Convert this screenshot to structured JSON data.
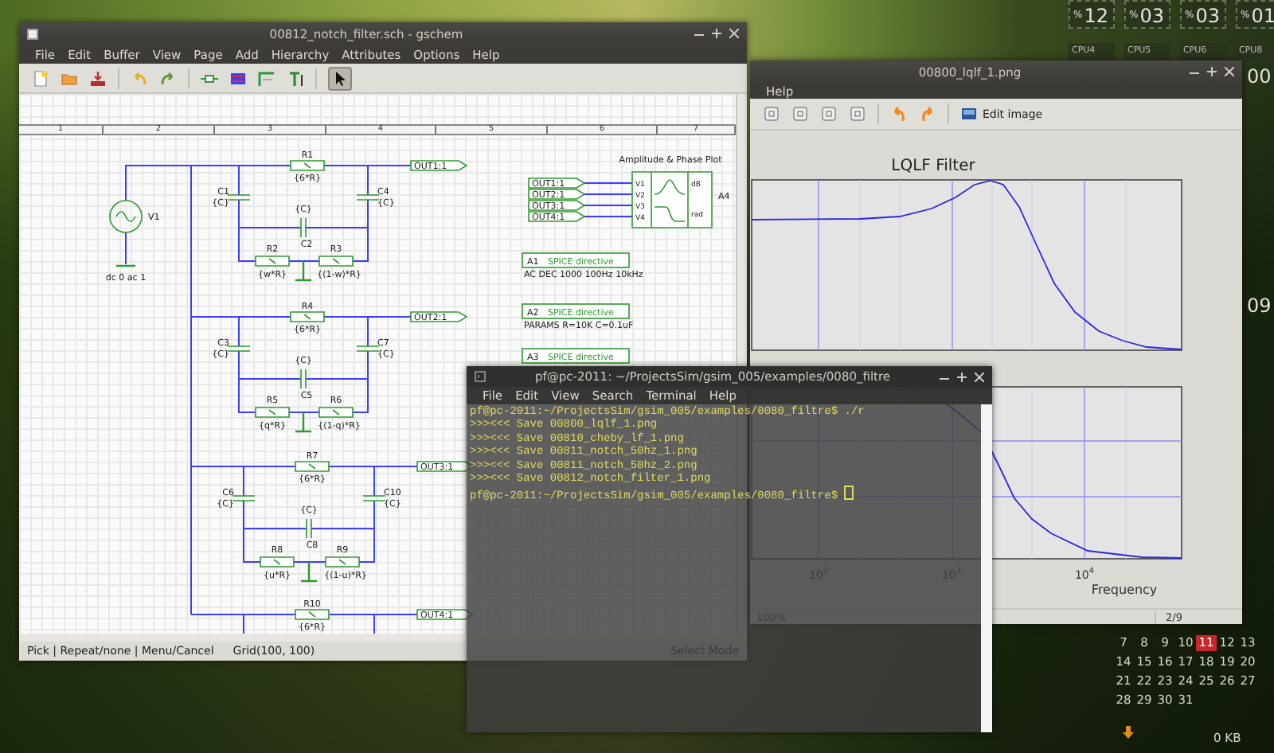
{
  "desktop": {
    "cpu_meters": [
      {
        "unit": "%",
        "value": "12"
      },
      {
        "unit": "%",
        "value": "03"
      },
      {
        "unit": "%",
        "value": "03"
      },
      {
        "unit": "%",
        "value": "01"
      }
    ],
    "cpu_labels": [
      "CPU4",
      "CPU5",
      "CPU6",
      "CPU8"
    ],
    "side_readings": [
      "00",
      "09"
    ],
    "calendar": [
      [
        {
          "day": "7",
          "selected": false
        },
        {
          "day": "8",
          "selected": false
        },
        {
          "day": "9",
          "selected": false
        },
        {
          "day": "10",
          "selected": false
        },
        {
          "day": "11",
          "selected": true
        },
        {
          "day": "12",
          "selected": false
        },
        {
          "day": "13",
          "selected": false
        }
      ],
      [
        {
          "day": "14",
          "selected": false
        },
        {
          "day": "15",
          "selected": false
        },
        {
          "day": "16",
          "selected": false
        },
        {
          "day": "17",
          "selected": false
        },
        {
          "day": "18",
          "selected": false
        },
        {
          "day": "19",
          "selected": false
        },
        {
          "day": "20",
          "selected": false
        }
      ],
      [
        {
          "day": "21",
          "selected": false
        },
        {
          "day": "22",
          "selected": false
        },
        {
          "day": "23",
          "selected": false
        },
        {
          "day": "24",
          "selected": false
        },
        {
          "day": "25",
          "selected": false
        },
        {
          "day": "26",
          "selected": false
        },
        {
          "day": "27",
          "selected": false
        }
      ],
      [
        {
          "day": "28",
          "selected": false
        },
        {
          "day": "29",
          "selected": false
        },
        {
          "day": "30",
          "selected": false
        },
        {
          "day": "31",
          "selected": false
        }
      ]
    ],
    "network": {
      "reading": "0 KB"
    }
  },
  "schematic_editor": {
    "title": "00812_notch_filter.sch - gschem",
    "menu": [
      "File",
      "Edit",
      "Buffer",
      "View",
      "Page",
      "Add",
      "Hierarchy",
      "Attributes",
      "Options",
      "Help"
    ],
    "select_tool_pressed": true,
    "ruler": [
      "1",
      "2",
      "3",
      "4",
      "5",
      "6",
      "7"
    ],
    "source": {
      "name": "V1",
      "value": "dc 0 ac 1"
    },
    "stages": [
      {
        "r_top": {
          "name": "R1",
          "value": "{6*R}"
        },
        "out": "OUT1:1",
        "c_left": {
          "name": "C1",
          "value": "{C}"
        },
        "c_right": {
          "name": "C4",
          "value": "{C}"
        },
        "c_mid": {
          "name": "C2",
          "value": "{C}"
        },
        "r_left": {
          "name": "R2",
          "value": "{w*R}"
        },
        "r_right": {
          "name": "R3",
          "value": "{(1-w)*R}"
        }
      },
      {
        "r_top": {
          "name": "R4",
          "value": "{6*R}"
        },
        "out": "OUT2:1",
        "c_left": {
          "name": "C3",
          "value": "{C}"
        },
        "c_right": {
          "name": "C7",
          "value": "{C}"
        },
        "c_mid": {
          "name": "C5",
          "value": "{C}"
        },
        "r_left": {
          "name": "R5",
          "value": "{q*R}"
        },
        "r_right": {
          "name": "R6",
          "value": "{(1-q)*R}"
        }
      },
      {
        "r_top": {
          "name": "R7",
          "value": "{6*R}"
        },
        "out": "OUT3:1",
        "c_left": {
          "name": "C6",
          "value": "{C}"
        },
        "c_right": {
          "name": "C10",
          "value": "{C}"
        },
        "c_mid": {
          "name": "C8",
          "value": "{C}"
        },
        "r_left": {
          "name": "R8",
          "value": "{u*R}"
        },
        "r_right": {
          "name": "R9",
          "value": "{(1-u)*R}"
        }
      },
      {
        "r_top": {
          "name": "R10",
          "value": "{6*R}"
        },
        "out": "OUT4:1"
      }
    ],
    "plot_block": {
      "title": "Amplitude & Phase Plot",
      "inputs": [
        "OUT1:1",
        "OUT2:1",
        "OUT3:1",
        "OUT4:1"
      ],
      "pins": [
        "V1",
        "V2",
        "V3",
        "V4"
      ],
      "outputs": [
        "dB",
        "rad"
      ],
      "name": "A4"
    },
    "directives": [
      {
        "name": "A1",
        "label": "SPICE directive",
        "text": "AC DEC 1000 100Hz 10kHz"
      },
      {
        "name": "A2",
        "label": "SPICE directive",
        "text": "PARAMS R=10K C=0.1uF"
      },
      {
        "name": "A3",
        "label": "SPICE directive"
      }
    ],
    "status": {
      "hints": "Pick | Repeat/none | Menu/Cancel",
      "grid": "Grid(100, 100)",
      "mode": "Select Mode"
    }
  },
  "image_viewer": {
    "title": "00800_lqlf_1.png",
    "menu": [
      "Help"
    ],
    "edit_label": "Edit image",
    "plot": {
      "title": "LQLF Filter",
      "xtick_labels": [
        "10$^{2}$",
        "10$^{3}$",
        "10$^{4}$"
      ],
      "xlabel": "Frequency"
    },
    "zoom": "100%",
    "page": "2/9"
  },
  "terminal": {
    "title": "pf@pc-2011: ~/ProjectsSim/gsim_005/examples/0080_filtre",
    "menu": [
      "File",
      "Edit",
      "View",
      "Search",
      "Terminal",
      "Help"
    ],
    "lines": [
      "pf@pc-2011:~/ProjectsSim/gsim_005/examples/0080_filtre$ ./r",
      ">>><<< Save 00800_lqlf_1.png",
      ">>><<< Save 00810_cheby_lf_1.png",
      ">>><<< Save 00811_notch_50hz_1.png",
      ">>><<< Save 00811_notch_50hz_2.png",
      ">>><<< Save 00812_notch_filter_1.png",
      "pf@pc-2011:~/ProjectsSim/gsim_005/examples/0080_filtre$ "
    ],
    "cursor": true
  }
}
